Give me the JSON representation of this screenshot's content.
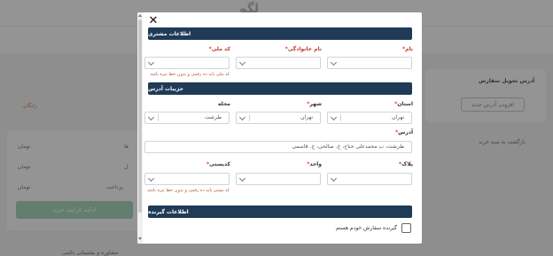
{
  "background": {
    "logo": "لگو",
    "address_title": "آدرس تحویل سفارش",
    "add_address": "افزودن آدرس جدید",
    "back_to_cart": "بازگشت به سبد خرید",
    "continue_button": "ادامه فرایند خرید",
    "support": "مشاوره و پشتیبانی دائمی",
    "side_labels": [
      "ها",
      "ل",
      "پرداخت"
    ],
    "side_values": [
      "تومان",
      "تومان",
      "تومان"
    ],
    "free_label": "رایگان"
  },
  "modal": {
    "close_icon": "close-icon",
    "customer_section": "اطلاعات مشتری",
    "first_name_label": "نام",
    "last_name_label": "نام خانوادگی",
    "national_code_label": "کد ملی",
    "national_code_hint": "کد ملی باید ده رقمی و بدون خط تیره باشد",
    "address_section": "جزییات آدرس",
    "province_label": "استان",
    "province_value": "تهران",
    "city_label": "شهر",
    "city_value": "تهران",
    "district_label": "محله",
    "district_value": "طرشت",
    "address_label": "آدرس",
    "address_value": "طرشت، ب محمدعلی جناح، خ. صالحی، خ. قاسمی",
    "plaque_label": "پلاک",
    "unit_label": "واحد",
    "postal_code_label": "کدپستی",
    "postal_code_hint": "کد پستی باید ده رقمی و بدون خط تیره باشد",
    "recipient_section": "اطلاعات گیرنده",
    "self_recipient_label": "گیرنده سفارش خودم هستم"
  }
}
